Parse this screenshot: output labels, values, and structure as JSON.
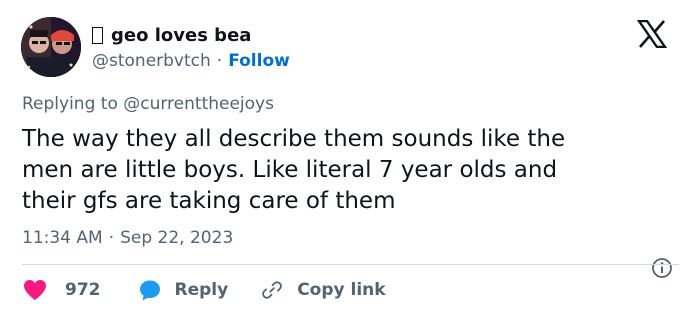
{
  "author": {
    "display_name": "geo loves bea",
    "handle": "@stonerbvtch",
    "follow_label": "Follow"
  },
  "replying": {
    "prefix": "Replying to",
    "mention": "@currenttheejoys"
  },
  "tweet": {
    "text_line1": "The way they all describe them sounds like the",
    "text_line2": "men are little boys. Like literal 7 year olds and",
    "text_line3": "their gfs are taking care of them"
  },
  "meta": {
    "time": "11:34 AM",
    "separator": "·",
    "date": "Sep 22, 2023"
  },
  "actions": {
    "like_count": "972",
    "reply_label": "Reply",
    "copy_label": "Copy link"
  },
  "colors": {
    "like": "#f91880",
    "reply": "#1d9bf0",
    "link": "#006fd6",
    "secondary": "#536471",
    "divider": "#cfd9de"
  },
  "icons": [
    "avatar",
    "x-logo-icon",
    "info-icon",
    "heart-icon",
    "reply-bubble-icon",
    "link-icon"
  ]
}
